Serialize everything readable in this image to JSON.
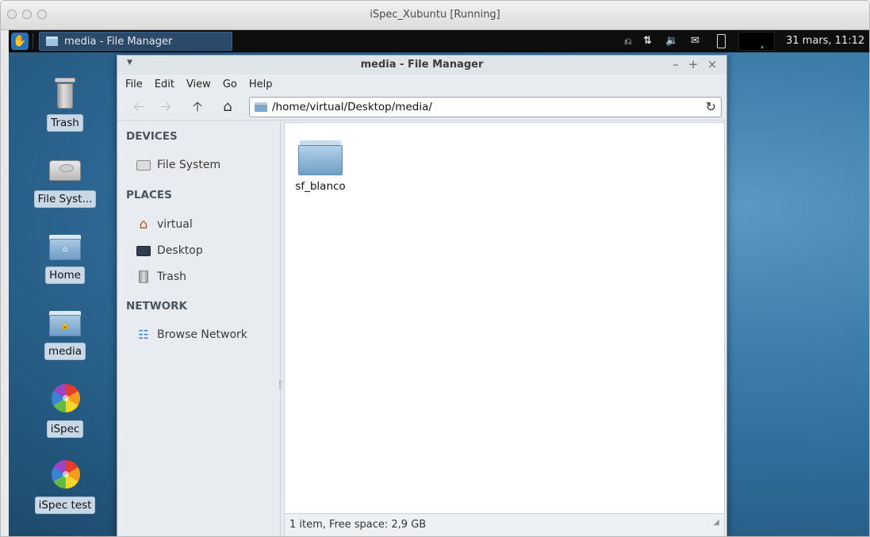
{
  "host_window": {
    "title": "iSpec_Xubuntu [Running]"
  },
  "panel": {
    "task_label": "media - File Manager",
    "clock": "31 mars, 11:12"
  },
  "desktop_icons": [
    {
      "label": "Trash",
      "icon": "trash-icon"
    },
    {
      "label": "File Syst...",
      "icon": "hard-drive-icon"
    },
    {
      "label": "Home",
      "icon": "home-folder-icon"
    },
    {
      "label": "media",
      "icon": "media-folder-icon"
    },
    {
      "label": "iSpec",
      "icon": "ispec-icon"
    },
    {
      "label": "iSpec test",
      "icon": "ispec-icon"
    }
  ],
  "file_manager": {
    "title": "media - File Manager",
    "menu": [
      "File",
      "Edit",
      "View",
      "Go",
      "Help"
    ],
    "location": "/home/virtual/Desktop/media/",
    "sidebar": {
      "devices_header": "DEVICES",
      "places_header": "PLACES",
      "network_header": "NETWORK",
      "devices": [
        {
          "label": "File System",
          "icon": "drive-icon"
        }
      ],
      "places": [
        {
          "label": "virtual",
          "icon": "home-icon"
        },
        {
          "label": "Desktop",
          "icon": "desktop-icon"
        },
        {
          "label": "Trash",
          "icon": "trash-icon"
        }
      ],
      "network": [
        {
          "label": "Browse Network",
          "icon": "wifi-icon"
        }
      ]
    },
    "items": [
      {
        "name": "sf_blanco",
        "icon": "folder-icon"
      }
    ],
    "status": "1 item, Free space: 2,9 GB"
  },
  "colors": {
    "accent": "#2f6c99",
    "panel": "#0e0e0e",
    "selection": "#2b4a6a"
  }
}
